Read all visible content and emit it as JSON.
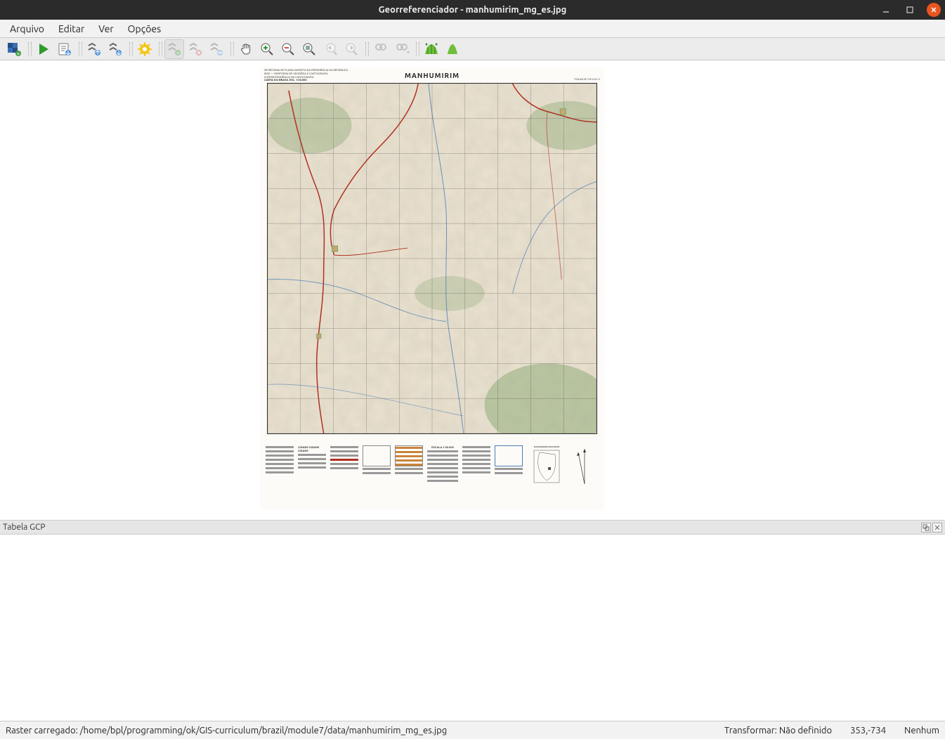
{
  "titlebar": {
    "title": "Georreferenciador - manhumirim_mg_es.jpg"
  },
  "menubar": {
    "items": [
      "Arquivo",
      "Editar",
      "Ver",
      "Opções"
    ]
  },
  "toolbar": {
    "open_raster": "Abrir Raster",
    "start": "Iniciar georreferenciamento",
    "save_gcp": "Gerar script GDAL",
    "load_gcp": "Carregar pontos GCP",
    "save_gcp_as": "Salvar pontos GCP como",
    "transformation_settings": "Configurações da transformação",
    "add_point": "Adicionar ponto",
    "delete_point": "Excluir ponto",
    "move_gcp": "Mover ponto GCP",
    "pan": "Panorâmica",
    "zoom_in": "Aproximar",
    "zoom_out": "Afastar",
    "zoom_layer": "Aproximar à camada",
    "zoom_last": "Última visualização",
    "zoom_next": "Próxima visualização",
    "link_georef": "Vincular georreferenciador ao QGIS",
    "link_qgis": "Vincular QGIS ao georreferenciador",
    "histogram": "Histograma completo",
    "local_histogram": "Histograma local"
  },
  "map": {
    "title": "MANHUMIRIM",
    "header_left_1": "SECRETARIA DE PLANEJAMENTO DA PRESIDÊNCIA DA REPÚBLICA",
    "header_left_2": "IBGE — DIRETORIA DE GEODÉSIA E CARTOGRAFIA",
    "header_left_3": "SUPERINTENDÊNCIA DE CARTOGRAFIA",
    "header_left_4": "CARTA DO BRASIL ESC. 1:50.000",
    "header_right": "FOLHA SF-24-V-A-I-3",
    "legend": {
      "cidade": "CIDADE CIDADE CIDADE",
      "escala": "ESCALA 1:50.000",
      "localizacao": "LOCALIZAÇÃO DA FOLHA"
    }
  },
  "gcp_panel": {
    "title": "Tabela GCP"
  },
  "statusbar": {
    "left": "Raster carregado: /home/bpl/programming/ok/GIS-curriculum/brazil/module7/data/manhumirim_mg_es.jpg",
    "transform": "Transformar: Não definido",
    "coords": "353,-734",
    "none": "Nenhum"
  }
}
